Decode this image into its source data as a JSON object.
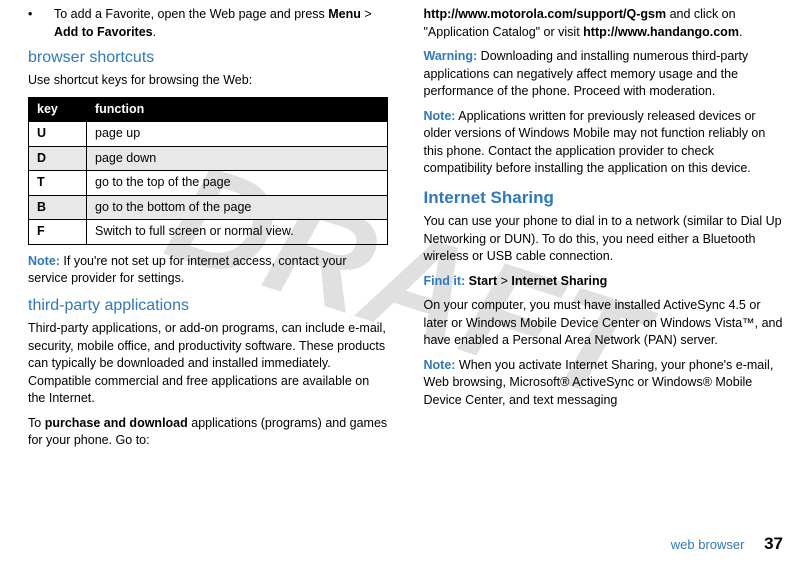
{
  "watermark": "DRAFT",
  "left": {
    "bullet": {
      "pre": "To add a Favorite, open the Web page and press ",
      "menu": "Menu",
      "sep": " > ",
      "add": "Add to Favorites",
      "post": "."
    },
    "shortcuts_title": "browser shortcuts",
    "shortcuts_intro": "Use shortcut keys for browsing the Web:",
    "table": {
      "h1": "key",
      "h2": "function",
      "rows": [
        {
          "k": "U",
          "f": "page up"
        },
        {
          "k": "D",
          "f": "page down"
        },
        {
          "k": "T",
          "f": "go to the top of the page"
        },
        {
          "k": "B",
          "f": "go to the bottom of the page"
        },
        {
          "k": "F",
          "f": "Switch to full screen or normal view."
        }
      ]
    },
    "note1_label": "Note:",
    "note1_text": " If you're not set up for internet access, contact your service provider for settings.",
    "thirdparty_title": "third-party applications",
    "thirdparty_p1": "Third-party applications, or add-on programs, can include e-mail, security, mobile office, and productivity software. These products can typically be downloaded and installed immediately. Compatible commercial and free applications are available on the Internet.",
    "thirdparty_p2_pre": "To ",
    "thirdparty_p2_bold": "purchase and download",
    "thirdparty_p2_post": " applications (programs) and games for your phone. Go to:"
  },
  "right": {
    "p1_url1": "http://www.motorola.com/support/Q-gsm",
    "p1_mid": " and click on \"Application Catalog\" or visit ",
    "p1_url2": "http://www.handango.com",
    "p1_post": ".",
    "warn_label": "Warning:",
    "warn_text": " Downloading and installing numerous third-party applications can negatively affect memory usage and the performance of the phone. Proceed with moderation.",
    "note2_label": "Note:",
    "note2_text": " Applications written for previously released devices or older versions of Windows Mobile may not function reliably on this phone. Contact the application provider to check compatibility before installing the application on this device.",
    "sharing_title": "Internet Sharing",
    "sharing_p1": "You can use your phone to dial in to a network (similar to Dial Up Networking or DUN). To do this, you need either a Bluetooth wireless or USB cable connection.",
    "findit_label": "Find it:",
    "findit_start": "Start",
    "findit_sep": " > ",
    "findit_sharing": "Internet Sharing",
    "sharing_p2": "On your computer, you must have installed ActiveSync 4.5 or later or Windows Mobile Device Center on Windows Vista™, and have enabled a Personal Area Network (PAN) server.",
    "note3_label": "Note:",
    "note3_text": " When you activate Internet Sharing, your phone's e-mail, Web browsing, Microsoft®  ActiveSync or Windows® Mobile Device Center, and text messaging"
  },
  "footer": {
    "label": "web browser",
    "page": "37"
  }
}
